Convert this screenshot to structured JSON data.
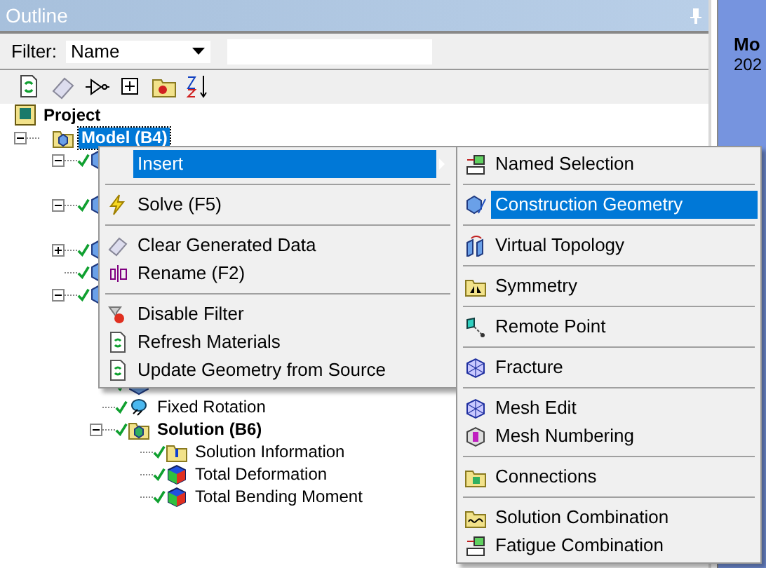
{
  "panel": {
    "title": "Outline",
    "filter_label": "Filter:",
    "filter_value": "Name"
  },
  "tree": [
    {
      "label": "Project",
      "kind": "project",
      "selected": false,
      "children": [
        {
          "label": "Model (B4)",
          "kind": "model",
          "selected": true,
          "checked": false,
          "expanded": true,
          "children": [
            {
              "kind": "item",
              "checked": true,
              "expanded": true
            },
            {
              "kind": "item",
              "checked": true,
              "expanded": true
            },
            {
              "kind": "item",
              "checked": true,
              "expanded": false
            },
            {
              "kind": "item",
              "checked": true
            },
            {
              "kind": "item",
              "checked": true,
              "expanded": true,
              "children": [
                {
                  "kind": "item",
                  "checked": true
                },
                {
                  "label": "Fixed Rotation",
                  "kind": "support",
                  "selected": false,
                  "checked": true
                },
                {
                  "label": "Solution (B6)",
                  "kind": "solution",
                  "selected": false,
                  "checked": true,
                  "expanded": true,
                  "children": [
                    {
                      "label": "Solution Information",
                      "kind": "info",
                      "selected": false,
                      "checked": true
                    },
                    {
                      "label": "Total Deformation",
                      "kind": "result",
                      "selected": false,
                      "checked": true
                    },
                    {
                      "label": "Total Bending Moment",
                      "kind": "result",
                      "selected": false,
                      "checked": true
                    }
                  ]
                }
              ]
            }
          ]
        }
      ]
    }
  ],
  "context_menu": [
    [
      {
        "label": "Insert",
        "selected": true,
        "submenu": true
      }
    ],
    [
      {
        "label": "Solve (F5)",
        "selected": false
      }
    ],
    [
      {
        "label": "Clear Generated Data",
        "selected": false
      },
      {
        "label": "Rename (F2)",
        "selected": false
      }
    ],
    [
      {
        "label": "Disable Filter",
        "selected": false
      },
      {
        "label": "Refresh Materials",
        "selected": false
      },
      {
        "label": "Update Geometry from Source",
        "selected": false
      }
    ]
  ],
  "submenu": [
    [
      {
        "label": "Named Selection",
        "selected": false
      }
    ],
    [
      {
        "label": "Construction Geometry",
        "selected": true
      }
    ],
    [
      {
        "label": "Virtual Topology",
        "selected": false
      }
    ],
    [
      {
        "label": "Symmetry",
        "selected": false
      }
    ],
    [
      {
        "label": "Remote Point",
        "selected": false
      }
    ],
    [
      {
        "label": "Fracture",
        "selected": false
      }
    ],
    [
      {
        "label": "Mesh Edit",
        "selected": false
      },
      {
        "label": "Mesh Numbering",
        "selected": false
      }
    ],
    [
      {
        "label": "Connections",
        "selected": false
      }
    ],
    [
      {
        "label": "Solution Combination",
        "selected": false
      },
      {
        "label": "Fatigue Combination",
        "selected": false
      }
    ]
  ],
  "side_panel": {
    "title": "Mo",
    "subtitle": "202"
  }
}
